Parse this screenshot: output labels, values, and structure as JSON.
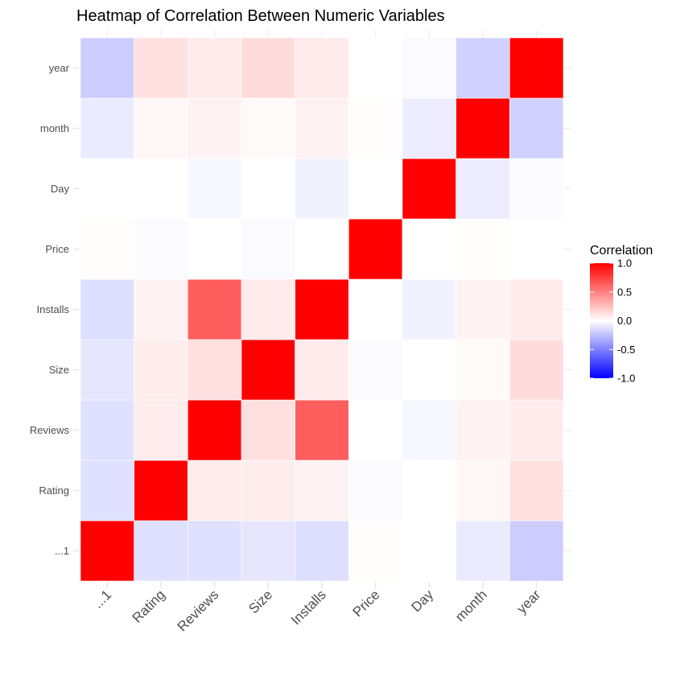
{
  "chart_data": {
    "type": "heatmap",
    "title": "Heatmap of Correlation Between Numeric Variables",
    "xlabel": "",
    "ylabel": "",
    "x_categories": [
      "...1",
      "Rating",
      "Reviews",
      "Size",
      "Installs",
      "Price",
      "Day",
      "month",
      "year"
    ],
    "y_categories": [
      "...1",
      "Rating",
      "Reviews",
      "Size",
      "Installs",
      "Price",
      "Day",
      "month",
      "year"
    ],
    "y_order": "bottom-to-top",
    "matrix": [
      [
        1.0,
        -0.12,
        -0.12,
        -0.1,
        -0.13,
        0.01,
        0.0,
        -0.08,
        -0.2
      ],
      [
        -0.12,
        1.0,
        0.07,
        0.07,
        0.05,
        -0.02,
        0.0,
        0.03,
        0.12
      ],
      [
        -0.12,
        0.07,
        1.0,
        0.12,
        0.63,
        0.0,
        -0.03,
        0.05,
        0.08
      ],
      [
        -0.1,
        0.07,
        0.12,
        1.0,
        0.08,
        -0.02,
        0.0,
        0.02,
        0.14
      ],
      [
        -0.13,
        0.05,
        0.63,
        0.08,
        1.0,
        0.0,
        -0.05,
        0.05,
        0.08
      ],
      [
        0.01,
        -0.02,
        0.0,
        -0.02,
        0.0,
        1.0,
        0.0,
        0.01,
        0.0
      ],
      [
        0.0,
        0.0,
        -0.03,
        0.0,
        -0.05,
        0.0,
        1.0,
        -0.07,
        -0.02
      ],
      [
        -0.08,
        0.03,
        0.05,
        0.02,
        0.05,
        0.01,
        -0.07,
        1.0,
        -0.18
      ],
      [
        -0.2,
        0.12,
        0.08,
        0.14,
        0.08,
        0.0,
        -0.02,
        -0.18,
        1.0
      ]
    ],
    "color_scale": {
      "low": "#0000FF",
      "mid": "#FFFFFF",
      "high": "#FF0000",
      "limits": [
        -1,
        1
      ],
      "midpoint": 0
    },
    "legend": {
      "title": "Correlation",
      "position": "right",
      "breaks": [
        1.0,
        0.5,
        0.0,
        -0.5,
        -1.0
      ],
      "labels": [
        "1.0",
        "0.5",
        "0.0",
        "-0.5",
        "-1.0"
      ]
    },
    "grid": true,
    "x_tick_rotation_deg": 45
  }
}
